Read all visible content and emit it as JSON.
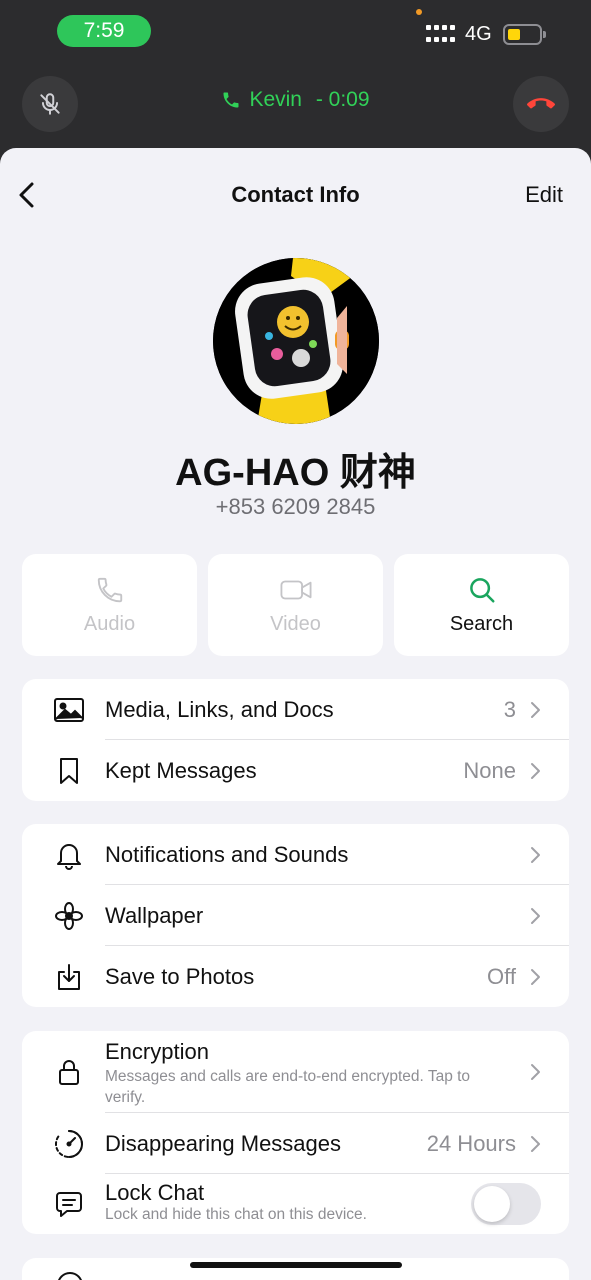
{
  "status_bar": {
    "time": "7:59",
    "network": "4G"
  },
  "call_bar": {
    "caller": "Kevin",
    "separator": " - ",
    "duration": "0:09"
  },
  "nav": {
    "title": "Contact Info",
    "edit_label": "Edit"
  },
  "contact": {
    "name": "AG-HAO 财神",
    "phone": "+853 6209 2845"
  },
  "actions": [
    {
      "label": "Audio",
      "icon": "phone-icon",
      "enabled": false
    },
    {
      "label": "Video",
      "icon": "video-icon",
      "enabled": false
    },
    {
      "label": "Search",
      "icon": "search-icon",
      "enabled": true
    }
  ],
  "media_group": [
    {
      "title": "Media, Links, and Docs",
      "value": "3",
      "icon": "image-icon"
    },
    {
      "title": "Kept Messages",
      "value": "None",
      "icon": "bookmark-icon"
    }
  ],
  "settings_group": [
    {
      "title": "Notifications and Sounds",
      "value": "",
      "icon": "bell-icon"
    },
    {
      "title": "Wallpaper",
      "value": "",
      "icon": "flower-icon"
    },
    {
      "title": "Save to Photos",
      "value": "Off",
      "icon": "download-icon"
    }
  ],
  "privacy_group": {
    "encryption": {
      "title": "Encryption",
      "subtitle": "Messages and calls are end-to-end encrypted. Tap to verify.",
      "icon": "lock-icon"
    },
    "disappearing": {
      "title": "Disappearing Messages",
      "value": "24 Hours",
      "icon": "timer-icon"
    },
    "lock_chat": {
      "title": "Lock Chat",
      "subtitle": "Lock and hide this chat on this device.",
      "icon": "chat-lock-icon",
      "enabled": false
    }
  },
  "colors": {
    "accent_green": "#2ec65a",
    "call_green": "#31d158",
    "hangup_red": "#ff453a",
    "search_green": "#1aa55e"
  }
}
